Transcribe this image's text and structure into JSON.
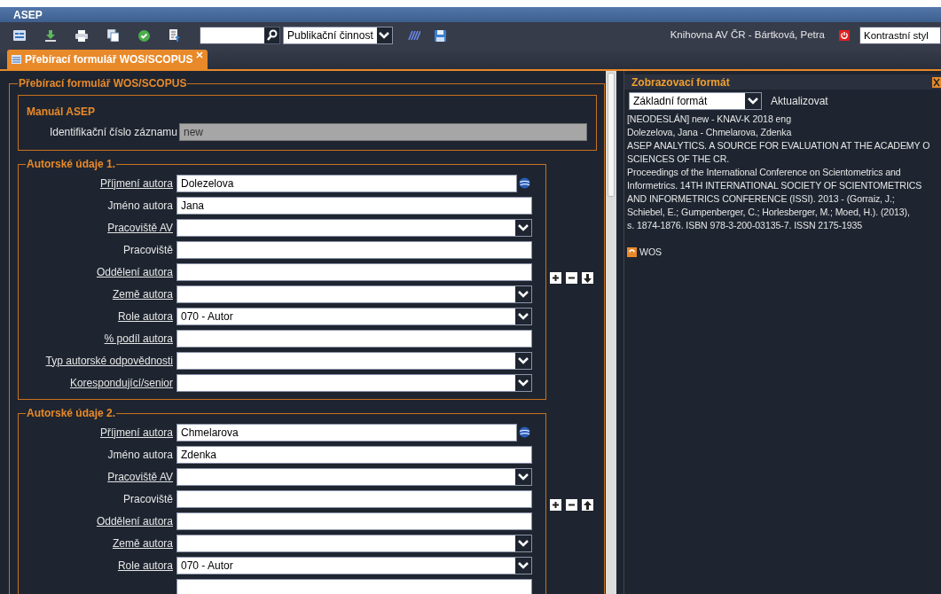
{
  "window": {
    "title": "ASEP"
  },
  "toolbar": {
    "module_select": {
      "value": "Publikační činnost"
    },
    "user": "Knihovna AV ČR - Bártková, Petra",
    "style_select": {
      "value": "Kontrastní styl"
    }
  },
  "tabs": [
    {
      "label": "Přebírací formulář WOS/SCOPUS",
      "selected": true
    }
  ],
  "form": {
    "title": "Přebírací formulář WOS/SCOPUS",
    "manual": {
      "title": "Manuál ASEP",
      "label": "Identifikační číslo záznamu",
      "value": "new"
    },
    "sections": [
      {
        "title": "Autorské údaje 1.",
        "moves_down": true,
        "fields": [
          {
            "label": "Příjmení autora",
            "link": true,
            "kind": "lookup",
            "value": "Dolezelova"
          },
          {
            "label": "Jméno autora",
            "link": false,
            "kind": "text",
            "value": "Jana"
          },
          {
            "label": "Pracoviště AV",
            "link": true,
            "kind": "select"
          },
          {
            "label": "Pracoviště",
            "link": false,
            "kind": "text"
          },
          {
            "label": "Oddělení autora",
            "link": true,
            "kind": "text"
          },
          {
            "label": "Země autora",
            "link": true,
            "kind": "select"
          },
          {
            "label": "Role autora",
            "link": true,
            "kind": "select",
            "value": "070 - Autor"
          },
          {
            "label": "% podíl autora",
            "link": true,
            "kind": "text"
          },
          {
            "label": "Typ autorské odpovědnosti",
            "link": true,
            "kind": "select"
          },
          {
            "label": "Korespondující/senior",
            "link": true,
            "kind": "select"
          }
        ]
      },
      {
        "title": "Autorské údaje 2.",
        "moves_down": false,
        "fields": [
          {
            "label": "Příjmení autora",
            "link": true,
            "kind": "lookup",
            "value": "Chmelarova"
          },
          {
            "label": "Jméno autora",
            "link": false,
            "kind": "text",
            "value": "Zdenka"
          },
          {
            "label": "Pracoviště AV",
            "link": true,
            "kind": "select"
          },
          {
            "label": "Pracoviště",
            "link": false,
            "kind": "text"
          },
          {
            "label": "Oddělení autora",
            "link": true,
            "kind": "text"
          },
          {
            "label": "Země autora",
            "link": true,
            "kind": "select"
          },
          {
            "label": "Role autora",
            "link": true,
            "kind": "select",
            "value": "070 - Autor"
          },
          {
            "kind": "text"
          }
        ]
      }
    ]
  },
  "preview": {
    "title": "Zobrazovací formát",
    "format_select": {
      "value": "Základní formát"
    },
    "refresh": "Aktualizovat",
    "lines": [
      "[NEODESLÁN] new - KNAV-K 2018 eng",
      "Dolezelova, Jana - Chmelarova, Zdenka",
      "ASEP ANALYTICS. A SOURCE FOR EVALUATION AT THE ACADEMY O",
      "SCIENCES OF THE CR.",
      "Proceedings of the International Conference on Scientometrics and",
      "Informetrics. 14TH INTERNATIONAL SOCIETY OF SCIENTOMETRICS",
      "AND INFORMETRICS CONFERENCE (ISSI). 2013 - (Gorraiz, J.;",
      "Schiebel, E.; Gumpenberger, C.; Horlesberger, M.; Moed, H.). (2013),",
      "s. 1874-1876. ISBN 978-3-200-03135-7. ISSN 2175-1935"
    ],
    "source": "WOS"
  }
}
